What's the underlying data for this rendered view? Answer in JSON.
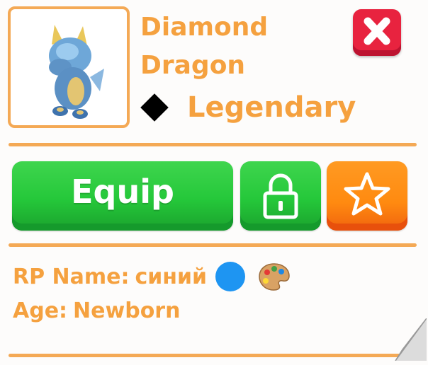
{
  "pet": {
    "name": "Diamond Dragon",
    "rarity": "Legendary",
    "portrait_icon": "diamond-dragon-icon",
    "rarity_icon": "black-diamond-icon"
  },
  "buttons": {
    "close_icon": "close-icon",
    "equip_label": "Equip",
    "lock_icon": "padlock-icon",
    "favorite_icon": "star-icon"
  },
  "info": {
    "rp_label": "RP Name:",
    "rp_value": "синий",
    "rp_color": "#1e95f2",
    "age_label": "Age:",
    "age_value": "Newborn"
  },
  "colors": {
    "accent_orange": "#f5a13f",
    "equip_green": "#25c83a",
    "close_red": "#e8233f",
    "favorite_orange": "#ff8a10"
  }
}
